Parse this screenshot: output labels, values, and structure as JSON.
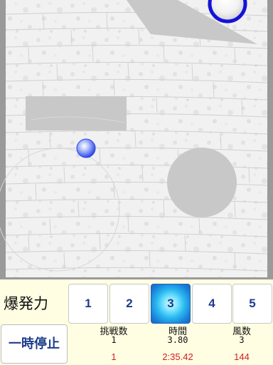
{
  "controls": {
    "power_label": "爆発力",
    "power_options": [
      "1",
      "2",
      "3",
      "4",
      "5"
    ],
    "selected_power": "3",
    "pause_label": "一時停止"
  },
  "stats": {
    "attempts": {
      "label": "挑戦数",
      "value": "1",
      "best": "1"
    },
    "time": {
      "label": "時間",
      "value": "3.80",
      "best": "2:35.42"
    },
    "wind": {
      "label": "風数",
      "value": "3",
      "best": "144"
    }
  },
  "colors": {
    "frame": "#9a9a9a",
    "wall": "#eeeeee",
    "obstacle": "#c8c8c8",
    "ball": "#3f5cf0",
    "goal_ring": "#1414d8",
    "panel": "#fffde2",
    "accent_red": "#d42020",
    "button_text": "#1d3c8a"
  }
}
